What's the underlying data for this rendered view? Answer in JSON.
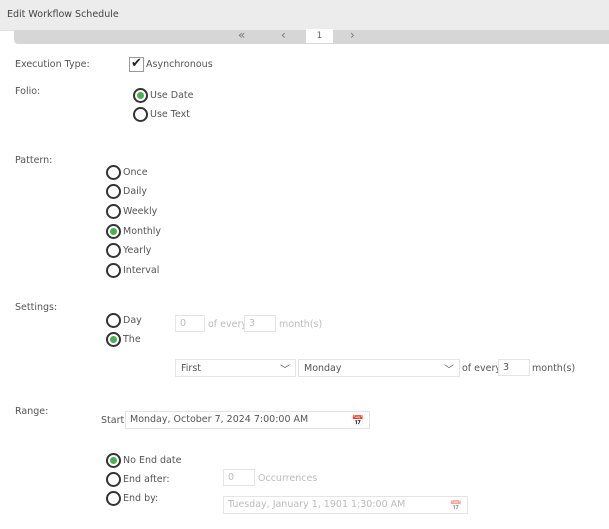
{
  "window": {
    "title": "Edit Workflow Schedule"
  },
  "pager": {
    "first_icon": "«",
    "prev_icon": "‹",
    "page": "1",
    "next_icon": "›"
  },
  "execution": {
    "label": "Execution Type:",
    "checkbox_label": "Asynchronous",
    "checked": true
  },
  "folio": {
    "label": "Folio:",
    "options": [
      {
        "label": "Use Date",
        "selected": true
      },
      {
        "label": "Use Text",
        "selected": false
      }
    ]
  },
  "pattern": {
    "label": "Pattern:",
    "options": [
      {
        "label": "Once"
      },
      {
        "label": "Daily"
      },
      {
        "label": "Weekly"
      },
      {
        "label": "Monthly",
        "selected": true
      },
      {
        "label": "Yearly"
      },
      {
        "label": "Interval"
      }
    ]
  },
  "settings": {
    "label": "Settings:",
    "day_label": "Day",
    "the_label": "The",
    "day_value": "0",
    "of_every": "of every",
    "day_months": "3",
    "months_label": "month(s)",
    "ordinal": "First",
    "weekday": "Monday",
    "the_months": "3"
  },
  "range": {
    "label": "Range:",
    "start_label": "Start:",
    "start_value": "Monday, October 7, 2024 7:00:00 AM",
    "no_end": "No End date",
    "end_after": "End after:",
    "occurrences_value": "0",
    "occurrences_label": "Occurrences",
    "end_by": "End by:",
    "end_by_value": "Tuesday, January 1, 1901 1:30:00 AM"
  },
  "accent": "#4caf50"
}
